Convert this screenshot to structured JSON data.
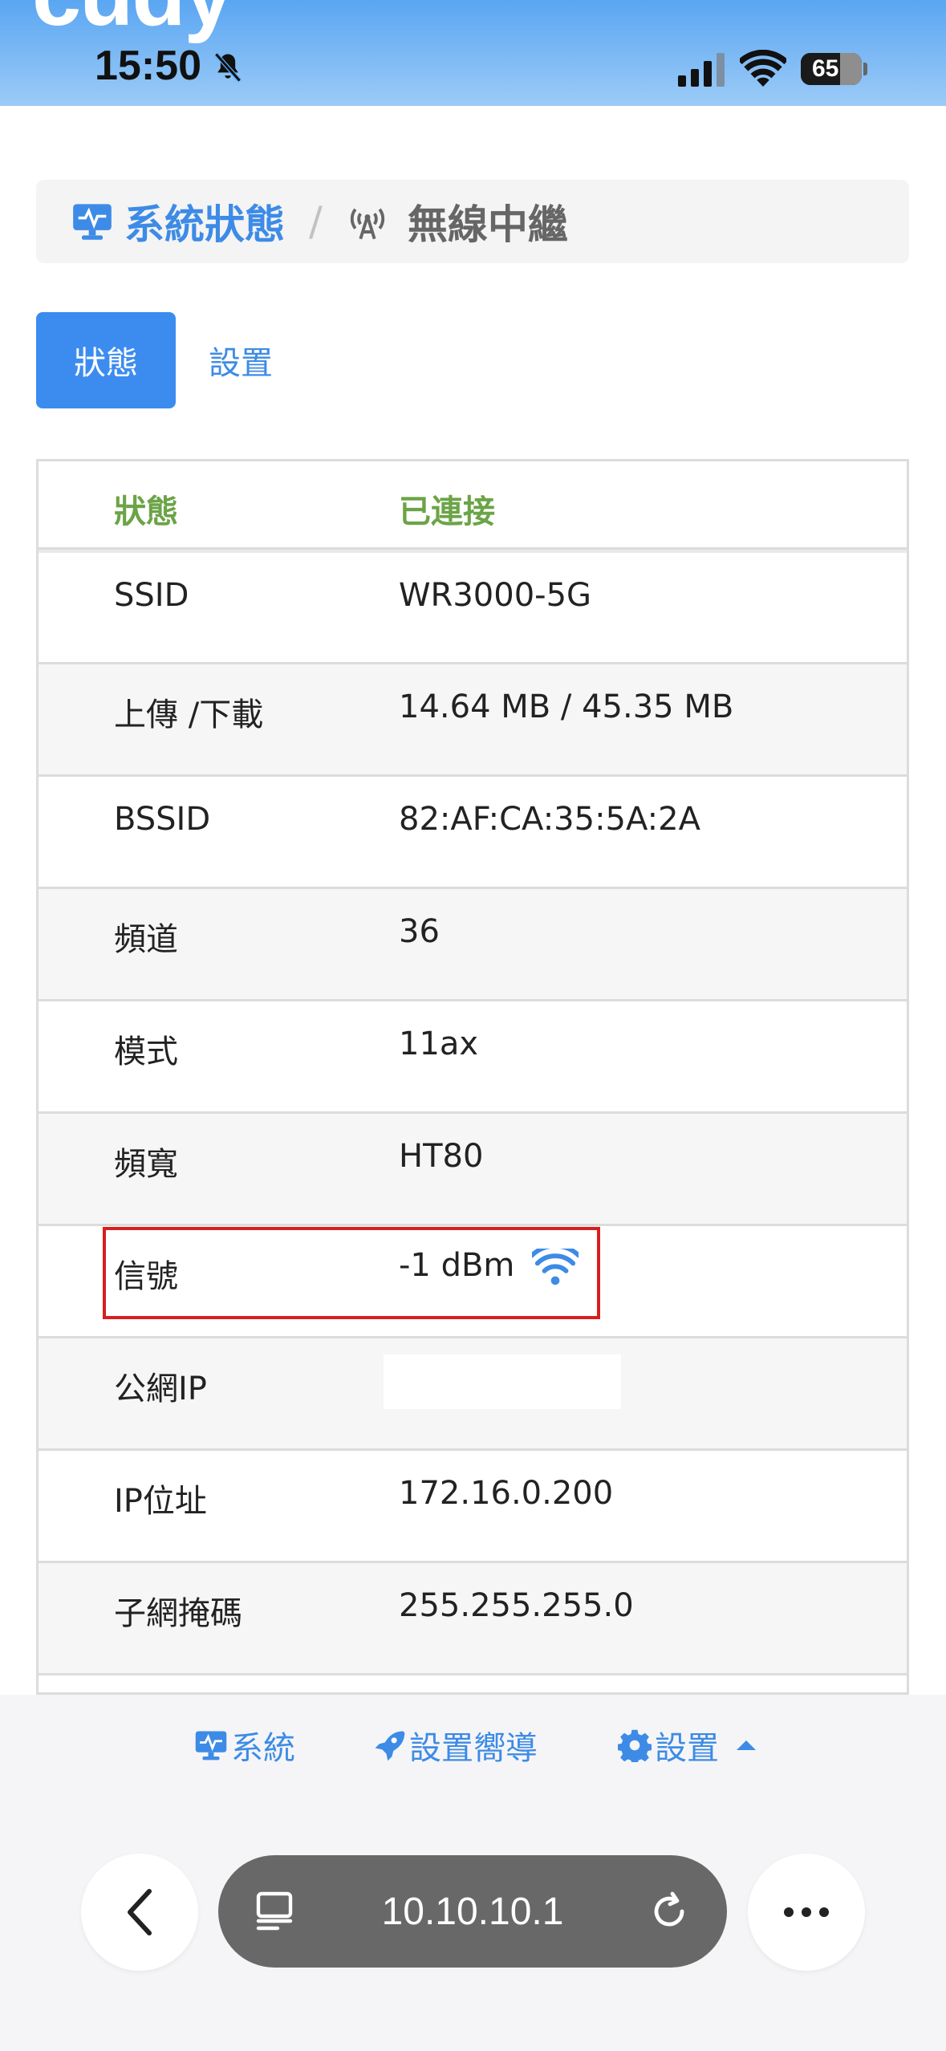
{
  "statusbar": {
    "logo_partial": "cudy",
    "time": "15:50",
    "battery": "65",
    "battery_level": 0.65
  },
  "breadcrumb": {
    "home": "系統狀態",
    "separator": "/",
    "current": "無線中繼"
  },
  "tabs": {
    "active": "狀態",
    "other": "設置"
  },
  "table": {
    "header": {
      "key": "狀態",
      "value": "已連接"
    },
    "rows": [
      {
        "key": "SSID",
        "value": "WR3000-5G"
      },
      {
        "key": "上傳 /下載",
        "value": "14.64 MB / 45.35 MB"
      },
      {
        "key": "BSSID",
        "value": "82:AF:CA:35:5A:2A"
      },
      {
        "key": "頻道",
        "value": "36"
      },
      {
        "key": "模式",
        "value": "11ax"
      },
      {
        "key": "頻寬",
        "value": "HT80"
      },
      {
        "key": "信號",
        "value": "-1 dBm"
      },
      {
        "key": "公網IP",
        "value": ""
      },
      {
        "key": "IP位址",
        "value": "172.16.0.200"
      },
      {
        "key": "子網掩碼",
        "value": "255.255.255.0"
      }
    ]
  },
  "bottom_menu": {
    "system": "系統",
    "wizard": "設置嚮導",
    "settings": "設置"
  },
  "browser": {
    "url": "10.10.10.1"
  },
  "colors": {
    "accent": "#3c8cf0",
    "connected": "#6ba446",
    "highlight": "#d81e1e"
  }
}
